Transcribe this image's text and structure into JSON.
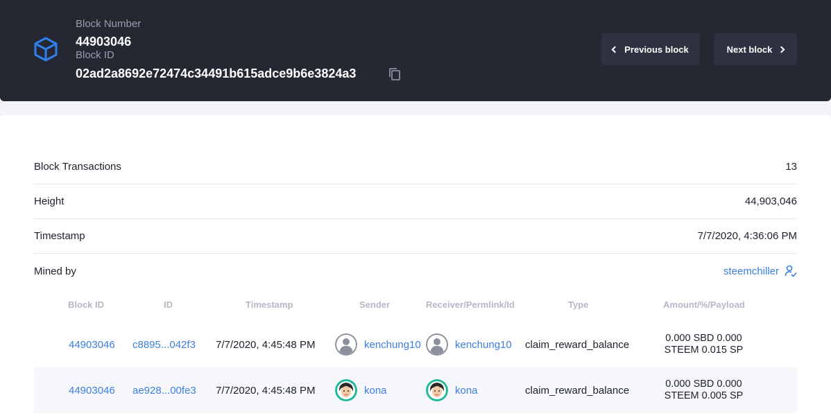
{
  "header": {
    "block_number_label": "Block Number",
    "block_number": "44903046",
    "block_id_label": "Block ID",
    "block_id": "02ad2a8692e72474c34491b615adce9b6e3824a3",
    "icons": {
      "block": "cube-icon",
      "copy": "copy-icon"
    },
    "prev_label": "Previous block",
    "next_label": "Next block"
  },
  "info": {
    "transactions_label": "Block Transactions",
    "transactions_value": "13",
    "height_label": "Height",
    "height_value": "44,903,046",
    "timestamp_label": "Timestamp",
    "timestamp_value": "7/7/2020, 4:36:06 PM",
    "mined_label": "Mined by",
    "mined_value": "steemchiller",
    "mined_icon": "user-check-icon"
  },
  "table": {
    "headers": [
      "Block ID",
      "ID",
      "Timestamp",
      "Sender",
      "Receiver/Permlink/Id",
      "Type",
      "Amount/%/Payload"
    ],
    "rows": [
      {
        "block_id": "44903046",
        "id": "c8895...042f3",
        "timestamp": "7/7/2020, 4:45:48 PM",
        "sender": "kenchung10",
        "receiver": "kenchung10",
        "type": "claim_reward_balance",
        "amount_line1": "0.000 SBD 0.000",
        "amount_line2": "STEEM 0.015 SP"
      },
      {
        "block_id": "44903046",
        "id": "ae928...00fe3",
        "timestamp": "7/7/2020, 4:45:48 PM",
        "sender": "kona",
        "receiver": "kona",
        "type": "claim_reward_balance",
        "amount_line1": "0.000 SBD 0.000",
        "amount_line2": "STEEM 0.005 SP"
      }
    ]
  },
  "colors": {
    "header_bg": "#252733",
    "button_bg": "#2f3140",
    "link": "#3d7fdc",
    "cube": "#2f80ed"
  }
}
